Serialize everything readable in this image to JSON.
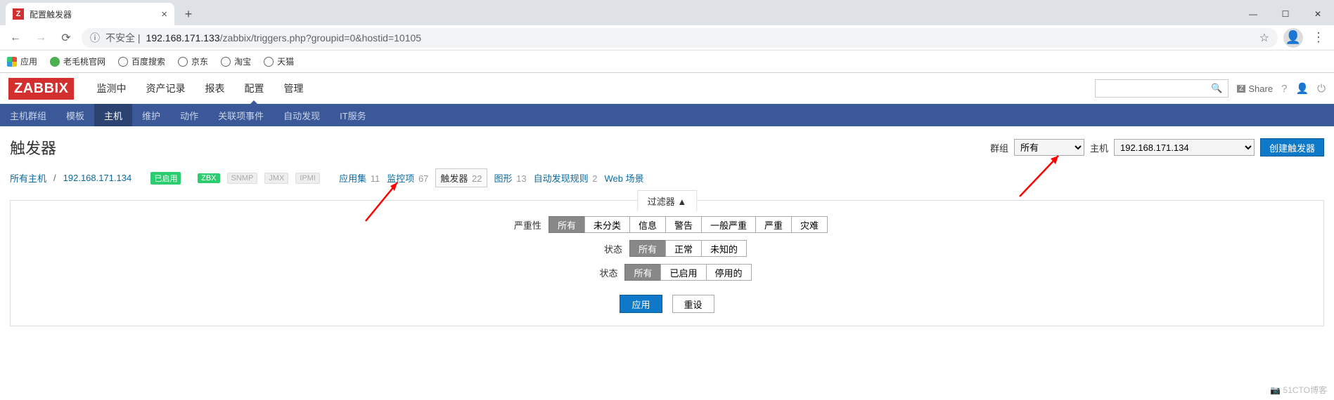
{
  "browser": {
    "tab_favicon": "Z",
    "tab_title": "配置触发器",
    "insecure_label": "不安全",
    "url_host": "192.168.171.133",
    "url_path": "/zabbix/triggers.php?groupid=0&hostid=10105",
    "bookmarks": {
      "apps": "应用",
      "items": [
        "老毛桃官网",
        "百度搜索",
        "京东",
        "淘宝",
        "天猫"
      ]
    }
  },
  "zabbix": {
    "logo": "ZABBIX",
    "mainnav": [
      "监测中",
      "资产记录",
      "报表",
      "配置",
      "管理"
    ],
    "mainnav_active": 3,
    "share": "Share",
    "subnav": [
      "主机群组",
      "模板",
      "主机",
      "维护",
      "动作",
      "关联项事件",
      "自动发现",
      "IT服务"
    ],
    "subnav_active": 2
  },
  "page": {
    "title": "触发器",
    "group_label": "群组",
    "group_value": "所有",
    "host_label": "主机",
    "host_value": "192.168.171.134",
    "create_btn": "创建触发器"
  },
  "crumbs": {
    "all_hosts": "所有主机",
    "host": "192.168.171.134",
    "enabled": "已启用",
    "zbx": "ZBX",
    "snmp": "SNMP",
    "jmx": "JMX",
    "ipmi": "IPMI",
    "tabs": [
      {
        "label": "应用集",
        "count": "11"
      },
      {
        "label": "监控项",
        "count": "67"
      },
      {
        "label": "触发器",
        "count": "22"
      },
      {
        "label": "图形",
        "count": "13"
      },
      {
        "label": "自动发现规则",
        "count": "2"
      },
      {
        "label": "Web 场景",
        "count": ""
      }
    ],
    "active_tab": 2
  },
  "filter": {
    "tab": "过滤器 ▲",
    "severity_label": "严重性",
    "severity_opts": [
      "所有",
      "未分类",
      "信息",
      "警告",
      "一般严重",
      "严重",
      "灾难"
    ],
    "state_label": "状态",
    "state_opts": [
      "所有",
      "正常",
      "未知的"
    ],
    "status_label": "状态",
    "status_opts": [
      "所有",
      "已启用",
      "停用的"
    ],
    "apply": "应用",
    "reset": "重设"
  },
  "watermark": "51CTO博客"
}
